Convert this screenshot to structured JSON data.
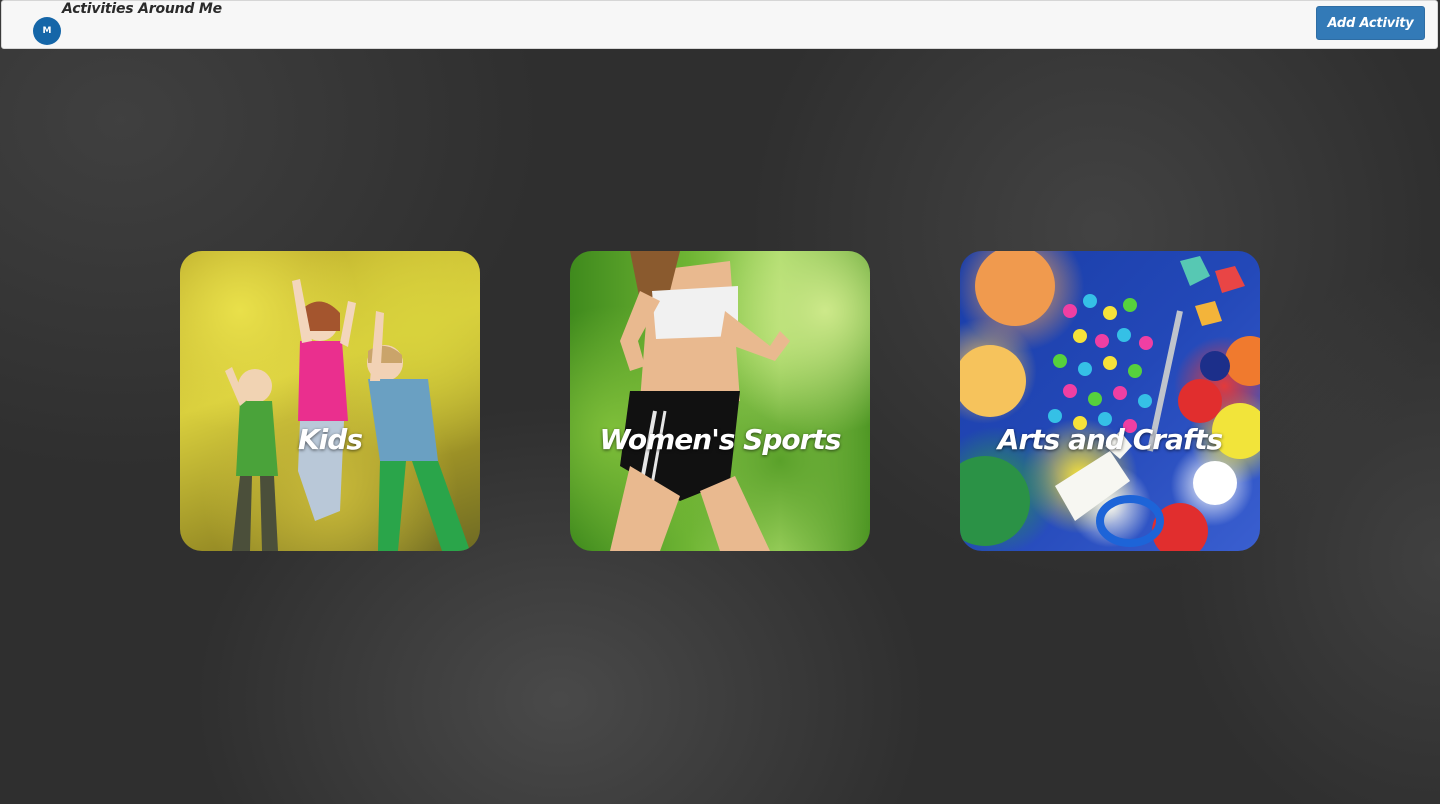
{
  "header": {
    "avatar_initial": "M",
    "title": "Activities Around Me",
    "add_button_label": "Add Activity"
  },
  "categories": [
    {
      "label": "Kids",
      "image": "children-jumping-photo"
    },
    {
      "label": "Women's Sports",
      "image": "woman-running-photo"
    },
    {
      "label": "Arts and Crafts",
      "image": "craft-supplies-photo"
    }
  ],
  "colors": {
    "header_bg": "#f7f7f7",
    "button_bg": "#337ab7",
    "avatar_bg": "#1566a8",
    "page_bg": "#2f2f2f",
    "card_label": "#ffffff"
  }
}
